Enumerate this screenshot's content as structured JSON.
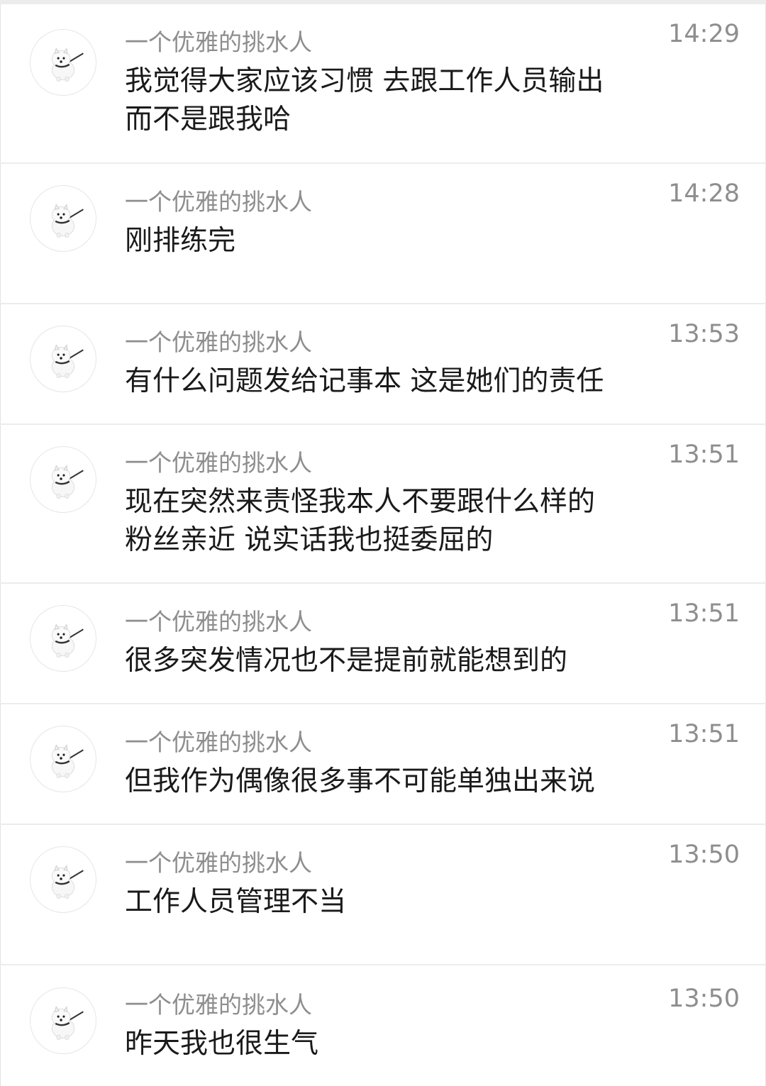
{
  "messages": [
    {
      "sender": "一个优雅的挑水人",
      "time": "14:29",
      "text": "我觉得大家应该习惯 去跟工作人员输出\n而不是跟我哈",
      "avatar_icon": "samoyed-dog-avatar-icon"
    },
    {
      "sender": "一个优雅的挑水人",
      "time": "14:28",
      "text": "刚排练完",
      "avatar_icon": "samoyed-dog-avatar-icon"
    },
    {
      "sender": "一个优雅的挑水人",
      "time": "13:53",
      "text": "有什么问题发给记事本 这是她们的责任",
      "avatar_icon": "samoyed-dog-avatar-icon"
    },
    {
      "sender": "一个优雅的挑水人",
      "time": "13:51",
      "text": "现在突然来责怪我本人不要跟什么样的\n粉丝亲近 说实话我也挺委屈的",
      "avatar_icon": "samoyed-dog-avatar-icon"
    },
    {
      "sender": "一个优雅的挑水人",
      "time": "13:51",
      "text": "很多突发情况也不是提前就能想到的",
      "avatar_icon": "samoyed-dog-avatar-icon"
    },
    {
      "sender": "一个优雅的挑水人",
      "time": "13:51",
      "text": "但我作为偶像很多事不可能单独出来说",
      "avatar_icon": "samoyed-dog-avatar-icon"
    },
    {
      "sender": "一个优雅的挑水人",
      "time": "13:50",
      "text": "工作人员管理不当",
      "avatar_icon": "samoyed-dog-avatar-icon"
    },
    {
      "sender": "一个优雅的挑水人",
      "time": "13:50",
      "text": "昨天我也很生气",
      "avatar_icon": "samoyed-dog-avatar-icon"
    }
  ],
  "colors": {
    "background": "#ececec",
    "card": "#ffffff",
    "meta_text": "#8e8e8e",
    "message_text": "#1a1a1a"
  }
}
